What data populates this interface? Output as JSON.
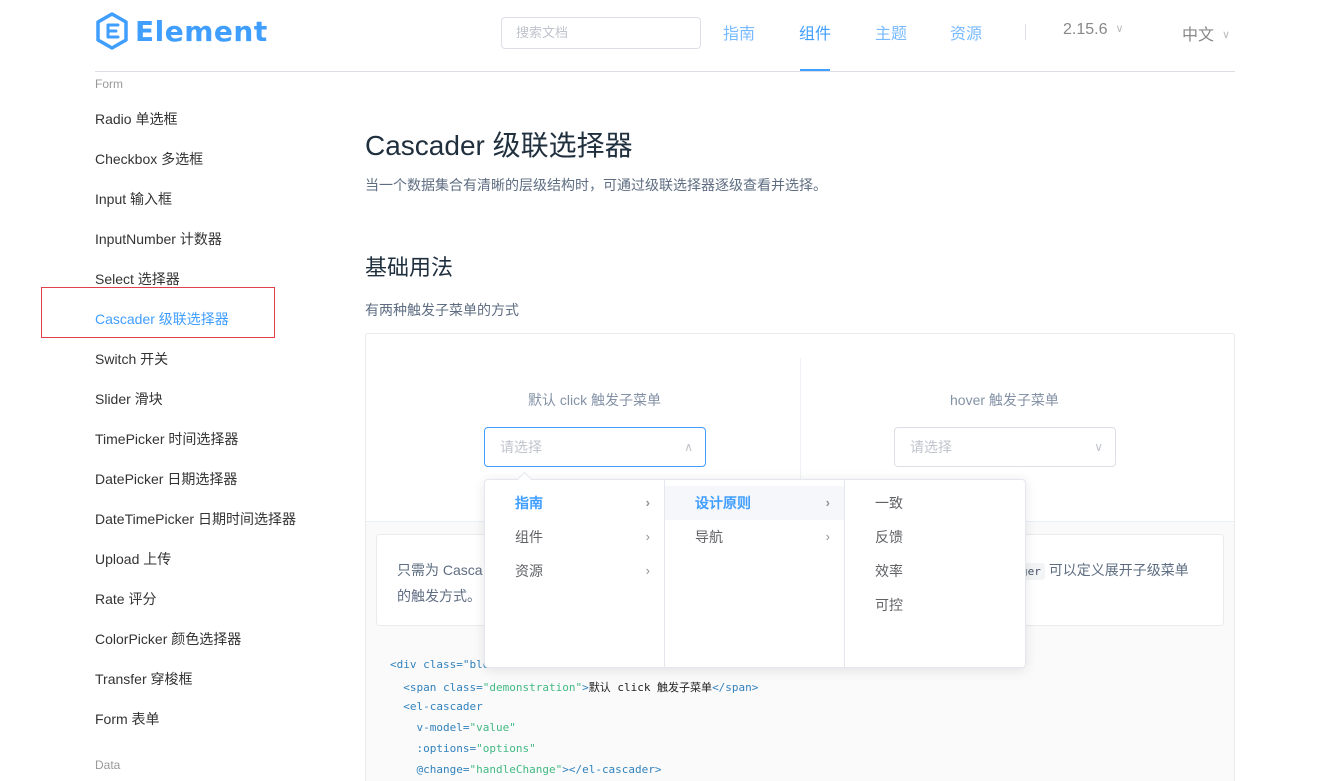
{
  "header": {
    "logo_text": "Element",
    "search_placeholder": "搜索文档",
    "nav": [
      "指南",
      "组件",
      "主题",
      "资源"
    ],
    "active_nav": "组件",
    "version": "2.15.6",
    "language": "中文"
  },
  "sidebar": {
    "group_form": "Form",
    "items": [
      "Radio 单选框",
      "Checkbox 多选框",
      "Input 输入框",
      "InputNumber 计数器",
      "Select 选择器",
      "Cascader 级联选择器",
      "Switch 开关",
      "Slider 滑块",
      "TimePicker 时间选择器",
      "DatePicker 日期选择器",
      "DateTimePicker 日期时间选择器",
      "Upload 上传",
      "Rate 评分",
      "ColorPicker 颜色选择器",
      "Transfer 穿梭框",
      "Form 表单"
    ],
    "active_item": "Cascader 级联选择器",
    "group_data": "Data"
  },
  "main": {
    "title": "Cascader 级联选择器",
    "description": "当一个数据集合有清晰的层级结构时，可通过级联选择器逐级查看并选择。",
    "section_title": "基础用法",
    "section_desc": "有两种触发子菜单的方式",
    "demo": {
      "left_label": "默认 click 触发子菜单",
      "right_label": "hover 触发子菜单",
      "left_placeholder": "请选择",
      "right_placeholder": "请选择"
    },
    "tip": {
      "part1": "只需为 Casca",
      "code": "ger",
      "part2": "可以定义展开子级菜单",
      "line2": "的触发方式。"
    },
    "code_lines": {
      "l1_tag": "<div class=\"blo",
      "l2_open": "<span class=",
      "l2_attr": "\"demonstration\"",
      "l2_close": ">",
      "l2_text": "默认 click 触发子菜单",
      "l2_end": "</span>",
      "l3": "<el-cascader",
      "l4_attr": "v-model=",
      "l4_val": "\"value\"",
      "l5_attr": ":options=",
      "l5_val": "\"options\"",
      "l6_attr": "@change=",
      "l6_val": "\"handleChange\"",
      "l6_end": "></el-cascader>"
    }
  },
  "cascader_menu": {
    "col1": [
      "指南",
      "组件",
      "资源"
    ],
    "col2": [
      "设计原则",
      "导航"
    ],
    "col3": [
      "一致",
      "反馈",
      "效率",
      "可控"
    ],
    "active_col1": "指南",
    "active_col2": "设计原则"
  }
}
